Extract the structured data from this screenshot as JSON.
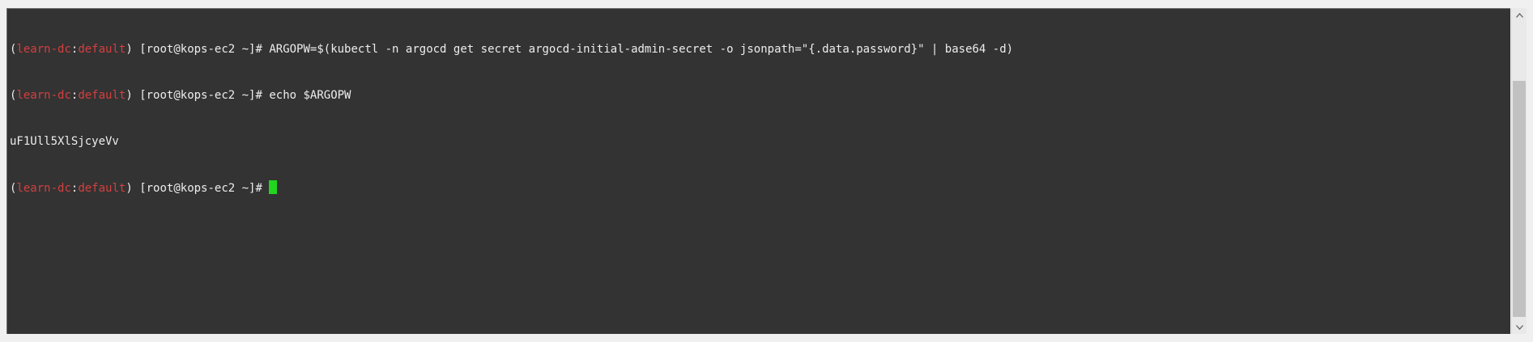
{
  "terminal": {
    "line1": {
      "open_paren": "(",
      "context": "learn-dc",
      "colon": ":",
      "namespace": "default",
      "close_paren": ")",
      "prompt": " [root@kops-ec2 ~]# ",
      "command": "ARGOPW=$(kubectl -n argocd get secret argocd-initial-admin-secret -o jsonpath=\"{.data.password}\" | base64 -d)"
    },
    "line2": {
      "open_paren": "(",
      "context": "learn-dc",
      "colon": ":",
      "namespace": "default",
      "close_paren": ")",
      "prompt": " [root@kops-ec2 ~]# ",
      "command": "echo $ARGOPW"
    },
    "line3": {
      "output": "uF1Ull5XlSjcyeVv"
    },
    "line4": {
      "open_paren": "(",
      "context": "learn-dc",
      "colon": ":",
      "namespace": "default",
      "close_paren": ")",
      "prompt": " [root@kops-ec2 ~]# "
    }
  },
  "colors": {
    "background": "#333333",
    "text": "#ededed",
    "context": "#d43f3f",
    "cursor": "#22d61f"
  },
  "scrollbar": {
    "up_icon": "scroll-up-arrow-icon",
    "down_icon": "scroll-down-arrow-icon"
  }
}
